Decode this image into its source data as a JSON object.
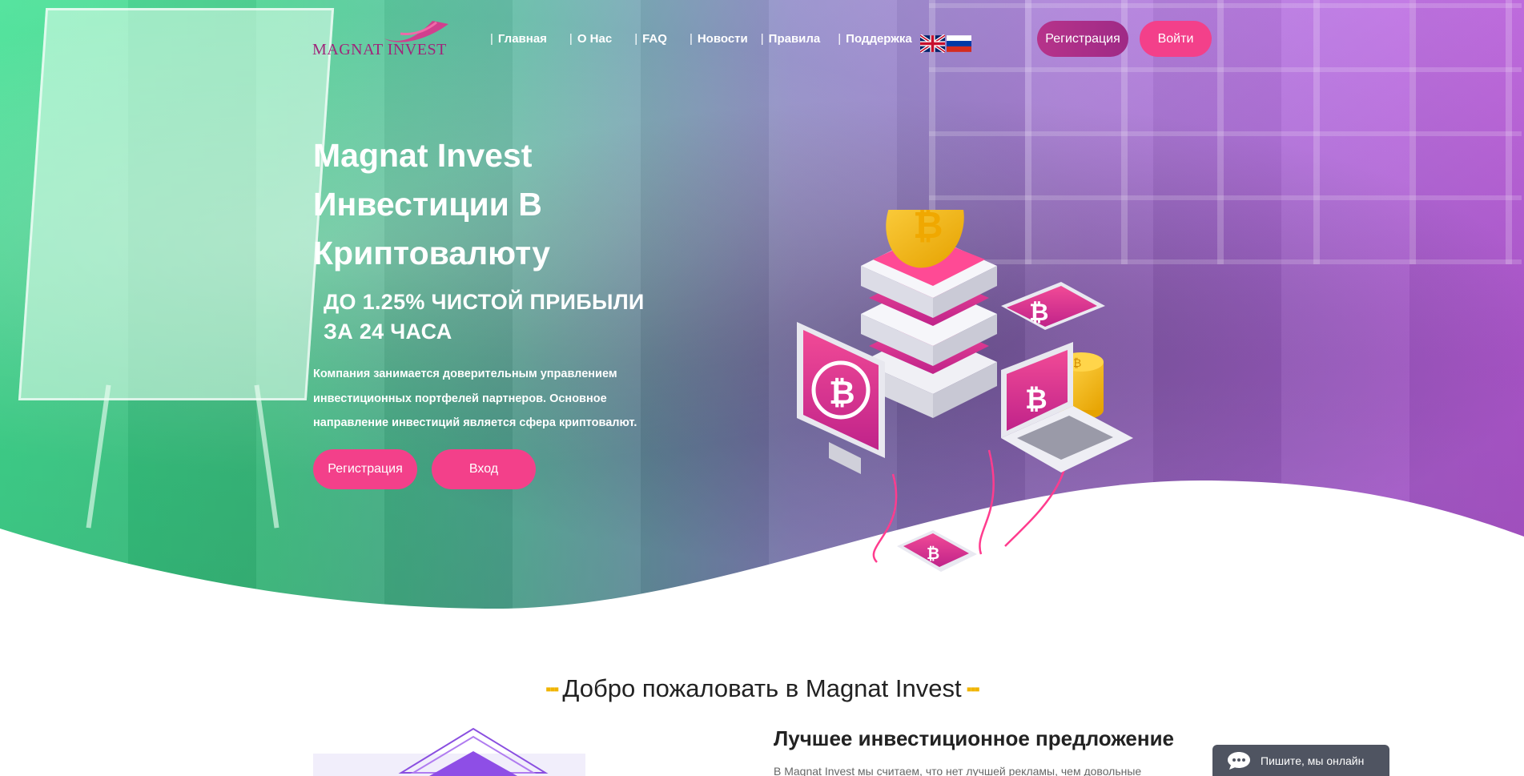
{
  "brand": {
    "logo_text": "MAGNAT INVEST",
    "accent": "#f3408a",
    "secondary": "#a0257a"
  },
  "nav": {
    "items": [
      {
        "label": "Главная"
      },
      {
        "label": "О Нас"
      },
      {
        "label": "FAQ"
      },
      {
        "label": "Новости"
      },
      {
        "label": "Правила"
      },
      {
        "label": "Поддержка"
      }
    ],
    "languages": [
      {
        "icon": "uk-flag-icon"
      },
      {
        "icon": "ru-flag-icon"
      }
    ],
    "register_label": "Регистрация",
    "login_label": "Войти"
  },
  "hero": {
    "title_line1": "Magnat Invest",
    "title_line2": "Инвестиции В",
    "title_line3": "Криптовалюту",
    "subtitle_line1": "ДО 1.25% ЧИСТОЙ ПРИБЫЛИ",
    "subtitle_line2": "ЗА 24 ЧАСА",
    "desc_line1": "Компания занимается доверительным управлением",
    "desc_line2": "инвестиционных портфелей партнеров. Основное",
    "desc_line3": "направление инвестиций является сфера криптовалют.",
    "register_label": "Регистрация",
    "login_label": "Вход"
  },
  "welcome": {
    "heading": "Добро пожаловать в Magnat Invest",
    "best_title": "Лучшее инвестиционное предложение",
    "best_text": "В Magnat Invest мы считаем, что нет лучшей рекламы, чем довольные"
  },
  "chat": {
    "label": "Пишите, мы онлайн",
    "icon": "chat-bubble-icon"
  }
}
